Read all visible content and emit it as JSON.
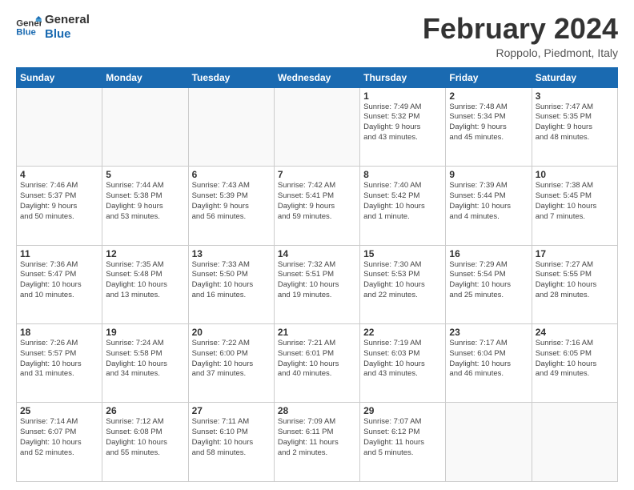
{
  "header": {
    "logo_line1": "General",
    "logo_line2": "Blue",
    "month": "February 2024",
    "location": "Roppolo, Piedmont, Italy"
  },
  "weekdays": [
    "Sunday",
    "Monday",
    "Tuesday",
    "Wednesday",
    "Thursday",
    "Friday",
    "Saturday"
  ],
  "weeks": [
    [
      {
        "day": "",
        "info": ""
      },
      {
        "day": "",
        "info": ""
      },
      {
        "day": "",
        "info": ""
      },
      {
        "day": "",
        "info": ""
      },
      {
        "day": "1",
        "info": "Sunrise: 7:49 AM\nSunset: 5:32 PM\nDaylight: 9 hours\nand 43 minutes."
      },
      {
        "day": "2",
        "info": "Sunrise: 7:48 AM\nSunset: 5:34 PM\nDaylight: 9 hours\nand 45 minutes."
      },
      {
        "day": "3",
        "info": "Sunrise: 7:47 AM\nSunset: 5:35 PM\nDaylight: 9 hours\nand 48 minutes."
      }
    ],
    [
      {
        "day": "4",
        "info": "Sunrise: 7:46 AM\nSunset: 5:37 PM\nDaylight: 9 hours\nand 50 minutes."
      },
      {
        "day": "5",
        "info": "Sunrise: 7:44 AM\nSunset: 5:38 PM\nDaylight: 9 hours\nand 53 minutes."
      },
      {
        "day": "6",
        "info": "Sunrise: 7:43 AM\nSunset: 5:39 PM\nDaylight: 9 hours\nand 56 minutes."
      },
      {
        "day": "7",
        "info": "Sunrise: 7:42 AM\nSunset: 5:41 PM\nDaylight: 9 hours\nand 59 minutes."
      },
      {
        "day": "8",
        "info": "Sunrise: 7:40 AM\nSunset: 5:42 PM\nDaylight: 10 hours\nand 1 minute."
      },
      {
        "day": "9",
        "info": "Sunrise: 7:39 AM\nSunset: 5:44 PM\nDaylight: 10 hours\nand 4 minutes."
      },
      {
        "day": "10",
        "info": "Sunrise: 7:38 AM\nSunset: 5:45 PM\nDaylight: 10 hours\nand 7 minutes."
      }
    ],
    [
      {
        "day": "11",
        "info": "Sunrise: 7:36 AM\nSunset: 5:47 PM\nDaylight: 10 hours\nand 10 minutes."
      },
      {
        "day": "12",
        "info": "Sunrise: 7:35 AM\nSunset: 5:48 PM\nDaylight: 10 hours\nand 13 minutes."
      },
      {
        "day": "13",
        "info": "Sunrise: 7:33 AM\nSunset: 5:50 PM\nDaylight: 10 hours\nand 16 minutes."
      },
      {
        "day": "14",
        "info": "Sunrise: 7:32 AM\nSunset: 5:51 PM\nDaylight: 10 hours\nand 19 minutes."
      },
      {
        "day": "15",
        "info": "Sunrise: 7:30 AM\nSunset: 5:53 PM\nDaylight: 10 hours\nand 22 minutes."
      },
      {
        "day": "16",
        "info": "Sunrise: 7:29 AM\nSunset: 5:54 PM\nDaylight: 10 hours\nand 25 minutes."
      },
      {
        "day": "17",
        "info": "Sunrise: 7:27 AM\nSunset: 5:55 PM\nDaylight: 10 hours\nand 28 minutes."
      }
    ],
    [
      {
        "day": "18",
        "info": "Sunrise: 7:26 AM\nSunset: 5:57 PM\nDaylight: 10 hours\nand 31 minutes."
      },
      {
        "day": "19",
        "info": "Sunrise: 7:24 AM\nSunset: 5:58 PM\nDaylight: 10 hours\nand 34 minutes."
      },
      {
        "day": "20",
        "info": "Sunrise: 7:22 AM\nSunset: 6:00 PM\nDaylight: 10 hours\nand 37 minutes."
      },
      {
        "day": "21",
        "info": "Sunrise: 7:21 AM\nSunset: 6:01 PM\nDaylight: 10 hours\nand 40 minutes."
      },
      {
        "day": "22",
        "info": "Sunrise: 7:19 AM\nSunset: 6:03 PM\nDaylight: 10 hours\nand 43 minutes."
      },
      {
        "day": "23",
        "info": "Sunrise: 7:17 AM\nSunset: 6:04 PM\nDaylight: 10 hours\nand 46 minutes."
      },
      {
        "day": "24",
        "info": "Sunrise: 7:16 AM\nSunset: 6:05 PM\nDaylight: 10 hours\nand 49 minutes."
      }
    ],
    [
      {
        "day": "25",
        "info": "Sunrise: 7:14 AM\nSunset: 6:07 PM\nDaylight: 10 hours\nand 52 minutes."
      },
      {
        "day": "26",
        "info": "Sunrise: 7:12 AM\nSunset: 6:08 PM\nDaylight: 10 hours\nand 55 minutes."
      },
      {
        "day": "27",
        "info": "Sunrise: 7:11 AM\nSunset: 6:10 PM\nDaylight: 10 hours\nand 58 minutes."
      },
      {
        "day": "28",
        "info": "Sunrise: 7:09 AM\nSunset: 6:11 PM\nDaylight: 11 hours\nand 2 minutes."
      },
      {
        "day": "29",
        "info": "Sunrise: 7:07 AM\nSunset: 6:12 PM\nDaylight: 11 hours\nand 5 minutes."
      },
      {
        "day": "",
        "info": ""
      },
      {
        "day": "",
        "info": ""
      }
    ]
  ]
}
